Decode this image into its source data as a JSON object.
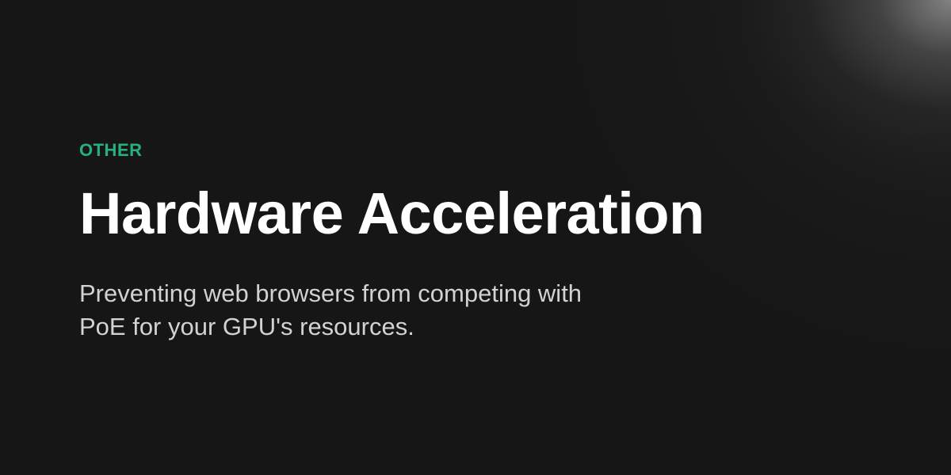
{
  "card": {
    "category": "OTHER",
    "title": "Hardware Acceleration",
    "subtitle": "Preventing web browsers from competing with PoE for your GPU's resources."
  },
  "colors": {
    "background": "#161616",
    "accent": "#25b27e",
    "title": "#ffffff",
    "subtitle": "#d2d2d2"
  }
}
